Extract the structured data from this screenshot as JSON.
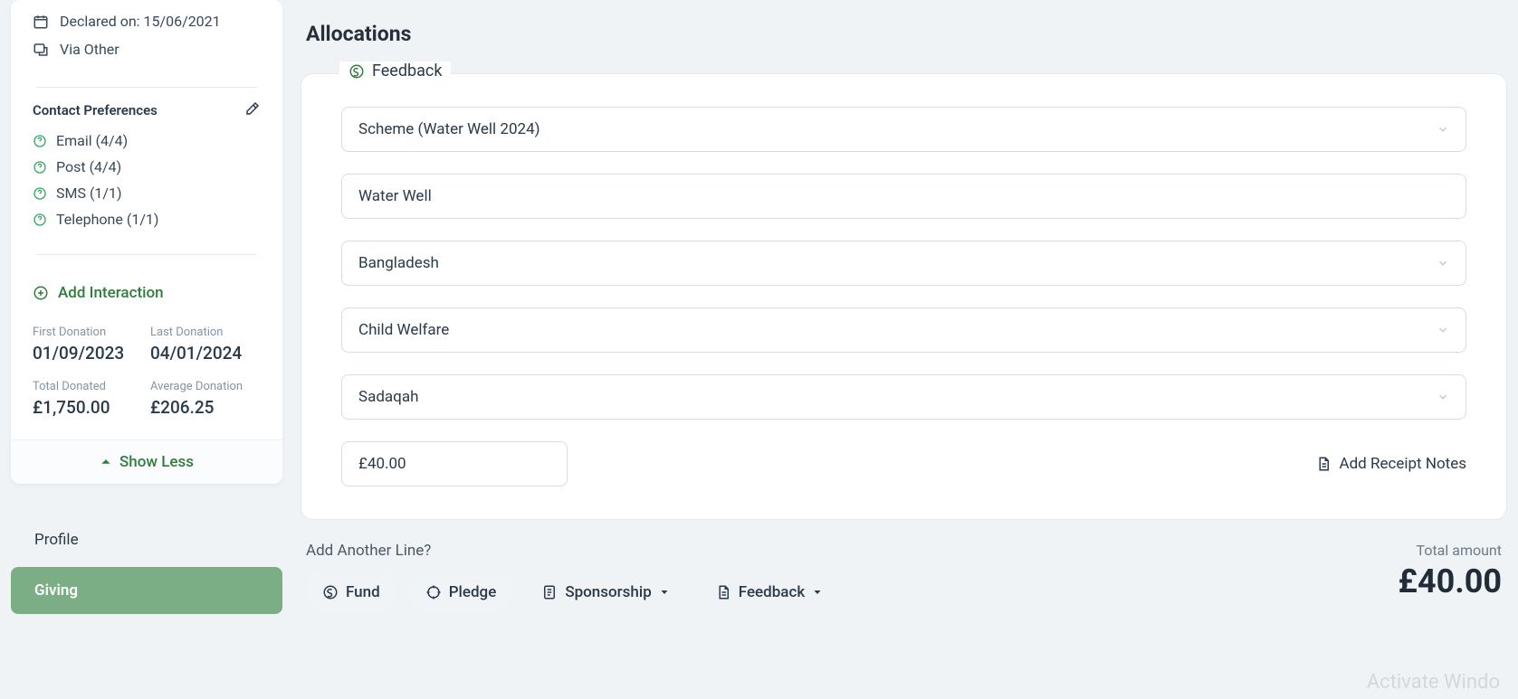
{
  "sidebar": {
    "declared_on_prefix": "Declared on: ",
    "declared_on_date": "15/06/2021",
    "via_other": "Via Other",
    "contact_prefs_heading": "Contact Preferences",
    "prefs": [
      {
        "label": "Email (4/4)"
      },
      {
        "label": "Post (4/4)"
      },
      {
        "label": "SMS (1/1)"
      },
      {
        "label": "Telephone (1/1)"
      }
    ],
    "add_interaction": "Add Interaction",
    "stats": {
      "first_donation_label": "First Donation",
      "first_donation_value": "01/09/2023",
      "last_donation_label": "Last Donation",
      "last_donation_value": "04/01/2024",
      "total_donated_label": "Total Donated",
      "total_donated_value": "£1,750.00",
      "average_donation_label": "Average Donation",
      "average_donation_value": "£206.25"
    },
    "show_less": "Show Less",
    "nav": {
      "profile": "Profile",
      "giving": "Giving"
    }
  },
  "main": {
    "title": "Allocations",
    "feedback_legend": "Feedback",
    "scheme": "Scheme (Water Well 2024)",
    "item_name": "Water Well",
    "country": "Bangladesh",
    "category": "Child Welfare",
    "fund_type": "Sadaqah",
    "amount": "£40.00",
    "add_receipt_notes": "Add Receipt Notes",
    "add_another_line": "Add Another Line?",
    "pills": {
      "fund": "Fund",
      "pledge": "Pledge",
      "sponsorship": "Sponsorship",
      "feedback": "Feedback"
    },
    "total_label": "Total amount",
    "total_value": "£40.00"
  },
  "watermark": "Activate Windo"
}
